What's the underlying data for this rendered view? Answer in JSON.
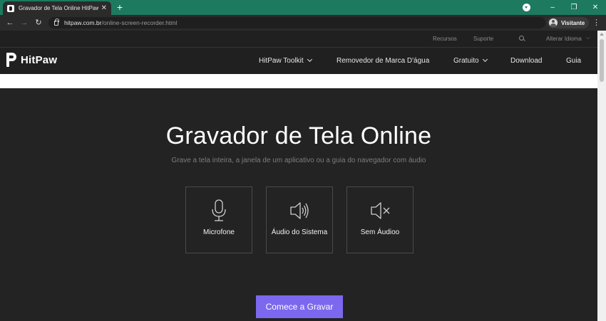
{
  "browser": {
    "tab_title": "Gravador de Tela Online HitPaw |",
    "tab_close": "✕",
    "new_tab": "+",
    "url_domain": "hitpaw.com.br",
    "url_path": "/online-screen-recorder.html",
    "profile_name": "Visitante",
    "minimize": "–",
    "restore": "❐",
    "close": "✕",
    "menu": "⋮",
    "back": "←",
    "forward": "→",
    "reload": "↻",
    "accent_color": "#1d7a5e"
  },
  "topbar": {
    "resources": "Recursos",
    "support": "Suporte",
    "language": "Alterar Idioma"
  },
  "nav": {
    "logo_text": "HitPaw",
    "toolkit": "HitPaw Toolkit",
    "watermark": "Removedor de Marca D'água",
    "free": "Gratuito",
    "download": "Download",
    "guide": "Guia"
  },
  "hero": {
    "title": "Gravador de Tela Online",
    "subtitle": "Grave a tela inteira, a janela de um aplicativo ou a guia do navegador com áudio",
    "options": [
      {
        "label": "Microfone",
        "icon": "microphone-icon"
      },
      {
        "label": "Áudio do Sistema",
        "icon": "speaker-icon"
      },
      {
        "label": "Sem Áudioo",
        "icon": "mute-icon"
      }
    ],
    "start_button": "Comece a Gravar",
    "button_color": "#7b68ee"
  }
}
